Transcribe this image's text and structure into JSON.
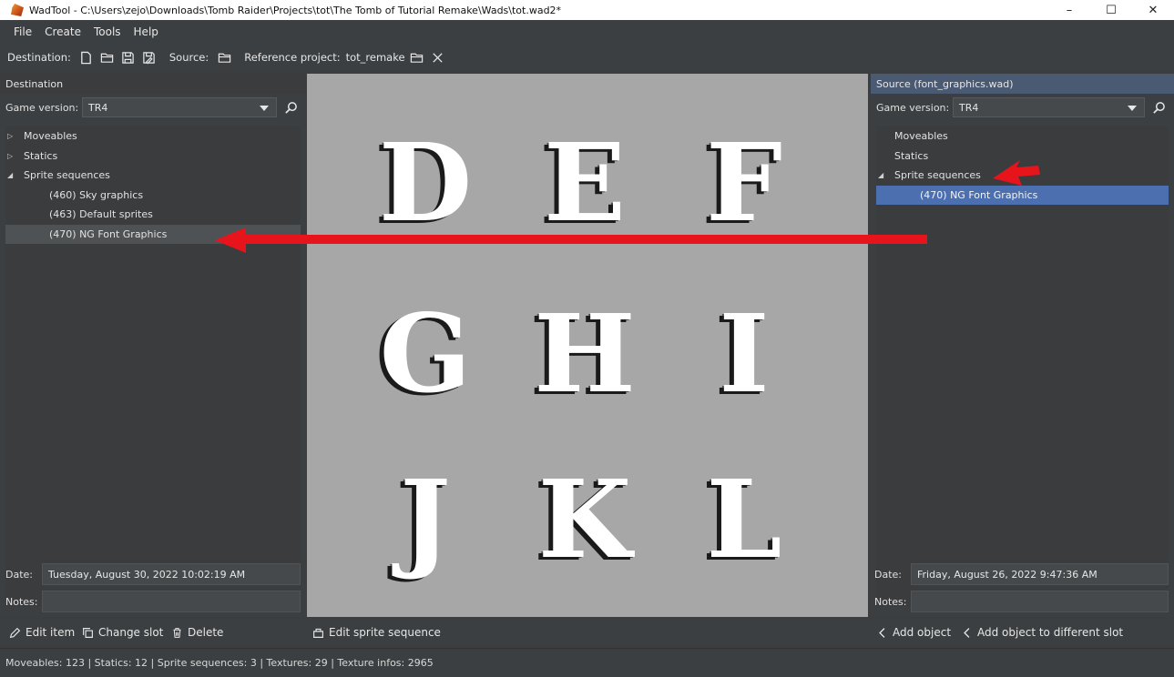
{
  "window": {
    "title": "WadTool - C:\\Users\\zejo\\Downloads\\Tomb Raider\\Projects\\tot\\The Tomb of Tutorial Remake\\Wads\\tot.wad2*",
    "minimize": "–",
    "maximize": "☐",
    "close": "✕"
  },
  "menu": [
    "File",
    "Create",
    "Tools",
    "Help"
  ],
  "toolbar": {
    "destination_label": "Destination:",
    "source_label": "Source:",
    "reference_label": "Reference project:",
    "reference_value": "tot_remake"
  },
  "destination": {
    "header": "Destination",
    "game_version_label": "Game version:",
    "game_version": "TR4",
    "tree": [
      {
        "label": "Moveables",
        "expander": "▷",
        "indent": 0
      },
      {
        "label": "Statics",
        "expander": "▷",
        "indent": 0
      },
      {
        "label": "Sprite sequences",
        "expander": "◢",
        "indent": 0
      },
      {
        "label": "(460) Sky graphics",
        "expander": "",
        "indent": 1
      },
      {
        "label": "(463) Default sprites",
        "expander": "",
        "indent": 1
      },
      {
        "label": "(470) NG Font Graphics",
        "expander": "",
        "indent": 1,
        "selected": true
      }
    ],
    "date_label": "Date:",
    "date": "Tuesday, August 30, 2022 10:02:19 AM",
    "notes_label": "Notes:",
    "notes": ""
  },
  "source": {
    "header": "Source (font_graphics.wad)",
    "game_version_label": "Game version:",
    "game_version": "TR4",
    "tree": [
      {
        "label": "Moveables",
        "expander": "",
        "indent": 0
      },
      {
        "label": "Statics",
        "expander": "",
        "indent": 0
      },
      {
        "label": "Sprite sequences",
        "expander": "◢",
        "indent": 0
      },
      {
        "label": "(470) NG Font Graphics",
        "expander": "",
        "indent": 1,
        "selected": true
      }
    ],
    "date_label": "Date:",
    "date": "Friday, August 26, 2022 9:47:36 AM",
    "notes_label": "Notes:",
    "notes": ""
  },
  "preview": {
    "glyphs": [
      "D",
      "E",
      "F",
      "G",
      "H",
      "I",
      "J",
      "K",
      "L"
    ]
  },
  "actions": {
    "edit_item": "Edit item",
    "change_slot": "Change slot",
    "delete": "Delete",
    "edit_sprite_sequence": "Edit sprite sequence",
    "add_object": "Add object",
    "add_object_different_slot": "Add object to different slot"
  },
  "status": "Moveables: 123 | Statics: 12 | Sprite sequences: 3 | Textures: 29 | Texture infos: 2965",
  "colors": {
    "annotation_red": "#e8141c",
    "selection_blue": "#4c6fb0",
    "panel_bg": "#3c3f41",
    "preview_bg": "#a7a7a7"
  }
}
